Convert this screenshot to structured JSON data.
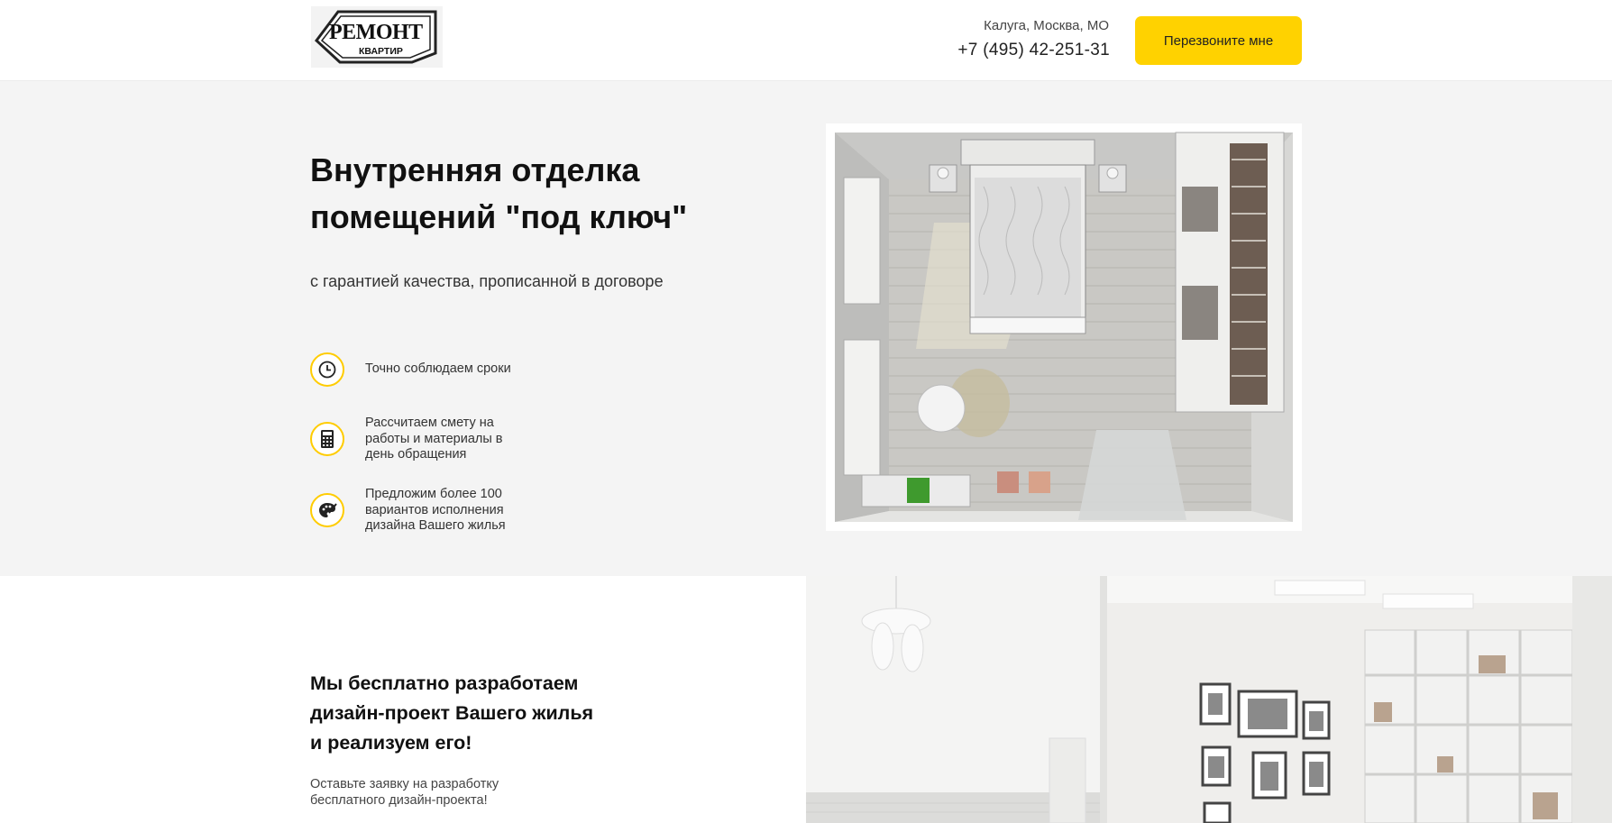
{
  "header": {
    "logo": {
      "line1": "РемонТ",
      "line2": "квартир"
    },
    "city": "Калуга, Москва, МО",
    "phone": "+7 (495) 42-251-31",
    "callback_label": "Перезвоните мне",
    "accent_color": "#ffd200"
  },
  "hero": {
    "title_line1": "Внутренняя отделка",
    "title_line2": "помещений \"под ключ\"",
    "subtitle": "с гарантией качества, прописанной в договоре",
    "features": [
      {
        "icon": "clock-icon",
        "text": "Точно соблюдаем сроки"
      },
      {
        "icon": "calculator-icon",
        "text": "Рассчитаем смету на работы и материалы в день обращения"
      },
      {
        "icon": "palette-icon",
        "text": "Предложим более 100 вариантов исполнения дизайна Вашего жилья"
      }
    ],
    "image": "bedroom-top-view-render"
  },
  "design_section": {
    "title_line1": "Мы бесплатно разработаем",
    "title_line2": "дизайн-проект Вашего жилья",
    "title_line3": "и реализуем его!",
    "subtitle": "Оставьте заявку на разработку бесплатного дизайн-проекта!",
    "image": "living-room-interior-render"
  }
}
